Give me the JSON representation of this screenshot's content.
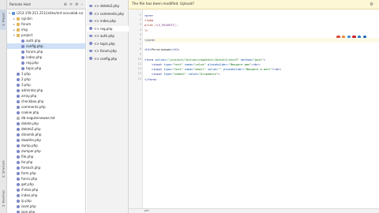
{
  "left_strip": {
    "tabs": [
      {
        "label": "1: Project",
        "active": true
      },
      {
        "label": "Z: Structure",
        "active": false
      },
      {
        "label": "2: Favorites",
        "active": false
      }
    ]
  },
  "remote_panel": {
    "header_title": "Remote Host",
    "tool_icons": [
      "globe-icon",
      "filter-icon",
      "gear-icon",
      "minimize-icon"
    ],
    "tree": [
      {
        "label": "(213.159.211.211)/sites/ent.nocualab.ru)",
        "depth": 0,
        "icon": "server",
        "expanded": true
      },
      {
        "label": "cgi-bin",
        "depth": 1,
        "icon": "folder"
      },
      {
        "label": "forum",
        "depth": 1,
        "icon": "folder"
      },
      {
        "label": "img",
        "depth": 1,
        "icon": "folder"
      },
      {
        "label": "project",
        "depth": 1,
        "icon": "folder",
        "expanded": true
      },
      {
        "label": "auth.php",
        "depth": 2,
        "icon": "php"
      },
      {
        "label": "config.php",
        "depth": 2,
        "icon": "php",
        "selected": true
      },
      {
        "label": "forum.php",
        "depth": 2,
        "icon": "php"
      },
      {
        "label": "index.php",
        "depth": 2,
        "icon": "php"
      },
      {
        "label": "reg.php",
        "depth": 2,
        "icon": "php"
      },
      {
        "label": "topic.php",
        "depth": 2,
        "icon": "php"
      },
      {
        "label": "1.php",
        "depth": 1,
        "icon": "php"
      },
      {
        "label": "2.php",
        "depth": 1,
        "icon": "php"
      },
      {
        "label": "3.php",
        "depth": 1,
        "icon": "php"
      },
      {
        "label": "admintor.php",
        "depth": 1,
        "icon": "php"
      },
      {
        "label": "array.php",
        "depth": 1,
        "icon": "php"
      },
      {
        "label": "checkbox.php",
        "depth": 1,
        "icon": "php"
      },
      {
        "label": "comments.php",
        "depth": 1,
        "icon": "php"
      },
      {
        "label": "cookie.php",
        "depth": 1,
        "icon": "php"
      },
      {
        "label": "db-nogutersewee.txt",
        "depth": 1,
        "icon": "txt"
      },
      {
        "label": "delete.php",
        "depth": 1,
        "icon": "php"
      },
      {
        "label": "delete2.php",
        "depth": 1,
        "icon": "php"
      },
      {
        "label": "dinamik.php",
        "depth": 1,
        "icon": "php"
      },
      {
        "label": "dowhile.php",
        "depth": 1,
        "icon": "php"
      },
      {
        "label": "dump.php",
        "depth": 1,
        "icon": "php"
      },
      {
        "label": "dumper.php",
        "depth": 1,
        "icon": "php"
      },
      {
        "label": "file.php",
        "depth": 1,
        "icon": "php"
      },
      {
        "label": "for.php",
        "depth": 1,
        "icon": "php"
      },
      {
        "label": "foreach.php",
        "depth": 1,
        "icon": "php"
      },
      {
        "label": "form.php",
        "depth": 1,
        "icon": "php"
      },
      {
        "label": "funcs.php",
        "depth": 1,
        "icon": "php"
      },
      {
        "label": "get.php",
        "depth": 1,
        "icon": "php"
      },
      {
        "label": "if-else.php",
        "depth": 1,
        "icon": "php"
      },
      {
        "label": "index.php",
        "depth": 1,
        "icon": "php"
      },
      {
        "label": "ip.php",
        "depth": 1,
        "icon": "php"
      },
      {
        "label": "isset.php",
        "depth": 1,
        "icon": "php"
      },
      {
        "label": "json.php",
        "depth": 1,
        "icon": "php"
      }
    ]
  },
  "file_tabs": [
    {
      "label": "<> delete2.php",
      "active": false
    },
    {
      "label": "<> comments.php",
      "active": false
    },
    {
      "label": "<> index.php",
      "active": false
    },
    {
      "label": "<> reg.php",
      "active": true
    },
    {
      "label": "<> auth.php",
      "active": false
    },
    {
      "label": "<> topic.php",
      "active": false
    },
    {
      "label": "<> forum.php",
      "active": false
    },
    {
      "label": "<> config.php",
      "active": false
    }
  ],
  "notification": {
    "text": "The file has been modified. Upload?",
    "icon": "gear-icon"
  },
  "editor": {
    "line_numbers": [
      "1",
      "2",
      "3",
      "4",
      "5",
      "6",
      "7",
      "8",
      "9",
      "10",
      "11",
      "12",
      "13",
      "14"
    ],
    "current_line": 6,
    "lines": [
      [
        {
          "t": "<pre>",
          "c": "tag"
        }
      ],
      [
        {
          "t": "<?php",
          "c": "kw"
        }
      ],
      [
        {
          "t": "print_r",
          "c": "kw"
        },
        {
          "t": "($_REQUEST);",
          "c": "var"
        }
      ],
      [
        {
          "t": "?>",
          "c": "kw"
        }
      ],
      [
        {
          "t": "",
          "c": ""
        }
      ],
      [
        {
          "t": "</pre>",
          "c": "tag"
        }
      ],
      [
        {
          "t": "",
          "c": ""
        }
      ],
      [
        {
          "t": "<h1>",
          "c": "tag"
        },
        {
          "t": "Регистрация",
          "c": ""
        },
        {
          "t": "</h1>",
          "c": "tag"
        }
      ],
      [
        {
          "t": "",
          "c": ""
        }
      ],
      [
        {
          "t": "<form ",
          "c": "tag"
        },
        {
          "t": "action=",
          "c": "attr"
        },
        {
          "t": "\"/project/?action=reg&test=1&test2=test3\" ",
          "c": "str"
        },
        {
          "t": "method=",
          "c": "attr"
        },
        {
          "t": "\"post\"",
          "c": "str"
        },
        {
          "t": ">",
          "c": "tag"
        }
      ],
      [
        {
          "t": "    <input ",
          "c": "tag"
        },
        {
          "t": "type=",
          "c": "attr"
        },
        {
          "t": "\"text\" ",
          "c": "str"
        },
        {
          "t": "name=",
          "c": "attr"
        },
        {
          "t": "\"value\" ",
          "c": "str"
        },
        {
          "t": "placeholder=",
          "c": "attr"
        },
        {
          "t": "\"Введите имя\"",
          "c": "str"
        },
        {
          "t": "><br>",
          "c": "tag"
        }
      ],
      [
        {
          "t": "    <input ",
          "c": "tag"
        },
        {
          "t": "type=",
          "c": "attr"
        },
        {
          "t": "\"text\" ",
          "c": "str"
        },
        {
          "t": "name=",
          "c": "attr"
        },
        {
          "t": "\"email\" ",
          "c": "str"
        },
        {
          "t": "value=",
          "c": "attr"
        },
        {
          "t": "\"\" ",
          "c": "str"
        },
        {
          "t": "placeholder=",
          "c": "attr"
        },
        {
          "t": "\"Введите e-mail\"",
          "c": "str"
        },
        {
          "t": "><br>",
          "c": "tag"
        }
      ],
      [
        {
          "t": "    <input ",
          "c": "tag"
        },
        {
          "t": "type=",
          "c": "attr"
        },
        {
          "t": "\"submit\" ",
          "c": "str"
        },
        {
          "t": "value=",
          "c": "attr"
        },
        {
          "t": "\"Отправить\"",
          "c": "str"
        },
        {
          "t": ">",
          "c": "tag"
        }
      ],
      [
        {
          "t": "</form>",
          "c": "tag"
        }
      ]
    ],
    "browser_icons": [
      {
        "name": "chrome-icon",
        "color": "#d94a3a"
      },
      {
        "name": "firefox-icon",
        "color": "#e8832f"
      },
      {
        "name": "safari-icon",
        "color": "#3d8fd9"
      },
      {
        "name": "opera-icon",
        "color": "#c8202c"
      },
      {
        "name": "ie-icon",
        "color": "#2a78c8"
      },
      {
        "name": "edge-icon",
        "color": "#2565b8"
      }
    ]
  },
  "status_bar": {
    "text": "pre"
  }
}
